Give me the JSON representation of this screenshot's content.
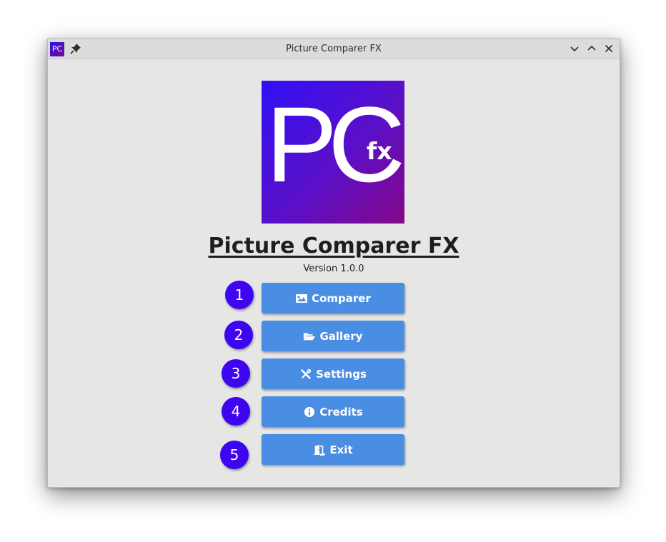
{
  "window": {
    "title": "Picture Comparer FX",
    "app_icon_text": "PC"
  },
  "logo": {
    "letter_p": "P",
    "letter_c": "C",
    "suffix": "fx",
    "gradient_start": "#3010f5",
    "gradient_end": "#85078a"
  },
  "app": {
    "title": "Picture Comparer FX",
    "version": "Version 1.0.0"
  },
  "menu": {
    "buttons": [
      {
        "label": "Comparer",
        "icon": "image-icon"
      },
      {
        "label": "Gallery",
        "icon": "folder-open-icon"
      },
      {
        "label": "Settings",
        "icon": "tools-icon"
      },
      {
        "label": "Credits",
        "icon": "info-icon"
      },
      {
        "label": "Exit",
        "icon": "door-exit-icon"
      }
    ],
    "button_color": "#4a8ee4"
  },
  "badges": [
    "1",
    "2",
    "3",
    "4",
    "5"
  ],
  "badge_color": "#3d05f0"
}
